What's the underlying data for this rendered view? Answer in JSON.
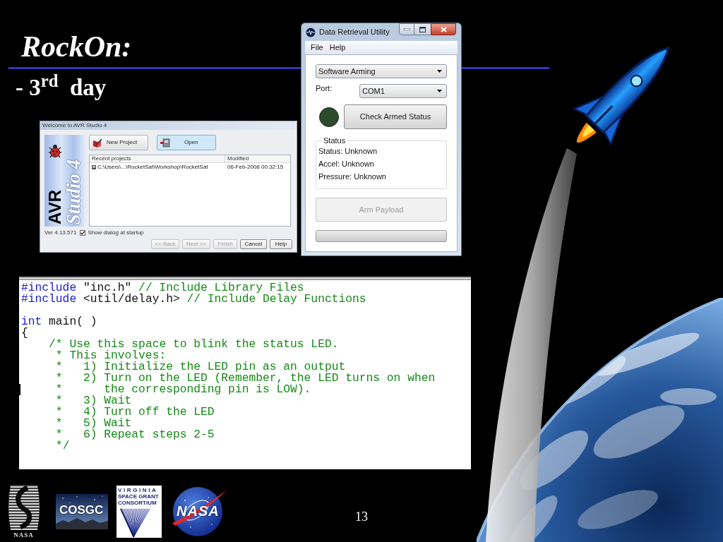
{
  "slide": {
    "title": "RockOn:",
    "subtitle": "- 3$^{rd}$  day",
    "page_number": "13"
  },
  "avr_dialog": {
    "title": "Welcome to AVR Studio 4",
    "logo": [
      "AVR",
      "Studio 4"
    ],
    "actions": [
      {
        "label": "New Project",
        "selected": false
      },
      {
        "label": "Open",
        "selected": true
      }
    ],
    "columns": [
      "Recent projects",
      "Modified"
    ],
    "rows": [
      {
        "path": "C:\\Users\\...\\RocketSat\\Workshop\\RocketSat",
        "modified": "06-Feb-2008 00:32:15"
      }
    ],
    "version": "Ver 4.13.571",
    "startup_option": {
      "label": "Show dialog at startup",
      "checked": true
    },
    "buttons": [
      {
        "label": "<< Back",
        "disabled": true
      },
      {
        "label": "Next >>",
        "disabled": true
      },
      {
        "label": "Finish",
        "disabled": true
      },
      {
        "label": "Cancel",
        "disabled": false
      },
      {
        "label": "Help",
        "disabled": false
      }
    ]
  },
  "data_utility": {
    "title": "Data Retrieval Utility",
    "menu": [
      "File",
      "Help"
    ],
    "mode": {
      "value": "Software Arming"
    },
    "port": {
      "label": "Port:",
      "value": "COM1"
    },
    "indicator": {
      "lit": false
    },
    "check_button": "Check Armed Status",
    "status": {
      "legend": "Status",
      "lines": [
        "Status: Unknown",
        "Accel: Unknown",
        "Pressure: Unknown"
      ]
    },
    "arm_button": {
      "label": "Arm Payload",
      "disabled": true
    },
    "progress": {
      "level": 0
    }
  },
  "code_editor": {
    "blocks": [
      {
        "lines": [
          {
            "tokens": [
              {
                "kind": "keyword",
                "text": "#include"
              },
              {
                "kind": "text",
                "text": " \"inc.h\" "
              },
              {
                "kind": "comment",
                "text": "// Include Library Files"
              }
            ]
          },
          {
            "tokens": [
              {
                "kind": "keyword",
                "text": "#include"
              },
              {
                "kind": "text",
                "text": " <util/delay.h> "
              },
              {
                "kind": "comment",
                "text": "// Include Delay Functions"
              }
            ]
          }
        ]
      },
      {
        "lines": [
          {
            "tokens": [
              {
                "kind": "keyword",
                "text": "int"
              },
              {
                "kind": "text",
                "text": " main( )"
              }
            ]
          },
          {
            "tokens": [
              {
                "kind": "text",
                "text": "{"
              }
            ]
          },
          {
            "tokens": [
              {
                "kind": "comment",
                "text": "    /* Use this space to blink the status LED."
              }
            ]
          },
          {
            "tokens": [
              {
                "kind": "comment",
                "text": "     * This involves:"
              }
            ]
          },
          {
            "tokens": [
              {
                "kind": "comment",
                "text": "     *   1) Initialize the LED pin as an output"
              }
            ]
          },
          {
            "tokens": [
              {
                "kind": "comment",
                "text": "     *   2) Turn on the LED (Remember, the LED turns on when"
              }
            ]
          },
          {
            "caret": true,
            "tokens": [
              {
                "kind": "comment",
                "text": "     *      the corresponding pin is LOW)."
              }
            ]
          },
          {
            "tokens": [
              {
                "kind": "comment",
                "text": "     *   3) Wait"
              }
            ]
          },
          {
            "tokens": [
              {
                "kind": "comment",
                "text": "     *   4) Turn off the LED"
              }
            ]
          },
          {
            "tokens": [
              {
                "kind": "comment",
                "text": "     *   5) Wait"
              }
            ]
          },
          {
            "tokens": [
              {
                "kind": "comment",
                "text": "     *   6) Repeat steps 2-5"
              }
            ]
          },
          {
            "tokens": [
              {
                "kind": "comment",
                "text": "     */"
              }
            ]
          }
        ]
      }
    ]
  },
  "logos": [
    {
      "kind": "emblem",
      "caption": "NASA"
    },
    {
      "kind": "sky",
      "wordmark": "COSGC"
    },
    {
      "kind": "fan",
      "lines": [
        "VIRGINIA",
        "SPACE GRANT",
        "CONSORTIUM"
      ]
    },
    {
      "kind": "globe",
      "wordmark": "NASA"
    }
  ]
}
